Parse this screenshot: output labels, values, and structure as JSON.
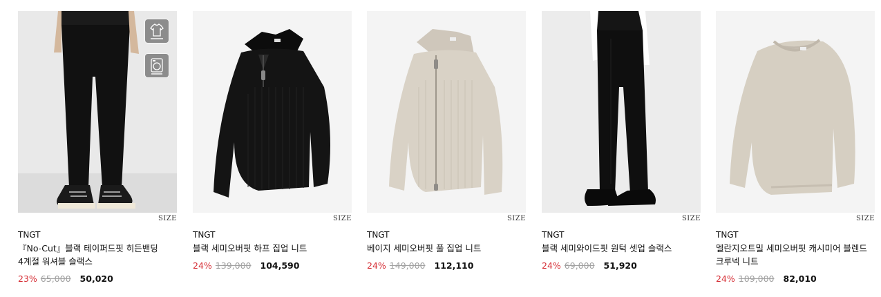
{
  "products": [
    {
      "brand": "TNGT",
      "title": "『No-Cut』블랙 테이퍼드핏 히든밴딩 4계절 워셔블 슬랙스",
      "discount": "23%",
      "original_price": "65,000",
      "price": "50,020",
      "size_label": "SIZE",
      "image": "black-tapered-slacks-photo",
      "care_icons": [
        "shirt-care-icon",
        "washer-care-icon"
      ]
    },
    {
      "brand": "TNGT",
      "title": "블랙 세미오버핏 하프 집업 니트",
      "discount": "24%",
      "original_price": "139,000",
      "price": "104,590",
      "size_label": "SIZE",
      "image": "black-half-zip-knit-photo"
    },
    {
      "brand": "TNGT",
      "title": "베이지 세미오버핏 풀 집업 니트",
      "discount": "24%",
      "original_price": "149,000",
      "price": "112,110",
      "size_label": "SIZE",
      "image": "beige-full-zip-knit-photo"
    },
    {
      "brand": "TNGT",
      "title": "블랙 세미와이드핏 원턱 셋업 슬랙스",
      "discount": "24%",
      "original_price": "69,000",
      "price": "51,920",
      "size_label": "SIZE",
      "image": "black-wide-slacks-photo"
    },
    {
      "brand": "TNGT",
      "title": "멜란지오트밀 세미오버핏 캐시미어 블렌드 크루넥 니트",
      "discount": "24%",
      "original_price": "109,000",
      "price": "82,010",
      "size_label": "SIZE",
      "image": "oatmeal-crewneck-knit-photo"
    }
  ],
  "colors": {
    "discount": "#d62f36",
    "original_price": "#a0a0a0",
    "text": "#111111"
  }
}
